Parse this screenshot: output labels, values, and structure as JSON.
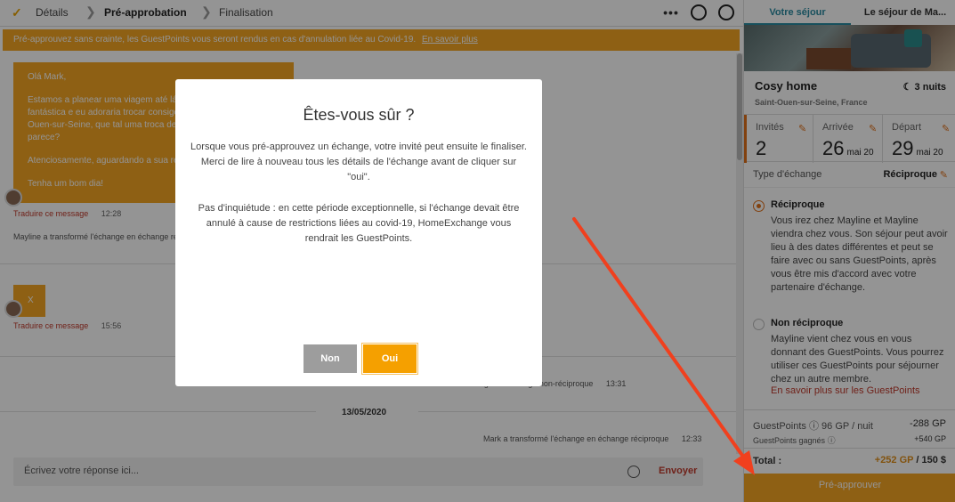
{
  "steps": {
    "details": "Détails",
    "preapproval": "Pré-approbation",
    "finalisation": "Finalisation"
  },
  "banner": {
    "text": "Pré-approuvez sans crainte, les GuestPoints vous seront rendus en cas d'annulation liée au Covid-19.",
    "link": "En savoir plus"
  },
  "messages": {
    "first": {
      "greeting": "Olá Mark,",
      "body": "Estamos a planear uma viagem até lá e a sua casa parece fantástica e eu adoraria trocar consigo. Vivemos em Saint-Ouen-sur-Seine, que tal uma troca de casas? O que lhe parece?",
      "regards": "Atenciosamente, aguardando a sua resposta",
      "bye": "Tenha um bom dia!",
      "translate": "Traduire ce message",
      "time": "12:28"
    },
    "system1": "Mayline a transformé l'échange en échange réciproque",
    "second": {
      "body": "X",
      "translate": "Traduire ce message",
      "time": "15:56"
    },
    "system2": "Mark a transformé l'échange en échange non-réciproque",
    "system2_time": "13:31",
    "date_sep": "13/05/2020",
    "system3": "Mark a transformé l'échange en échange réciproque",
    "system3_time": "12:33"
  },
  "reply": {
    "placeholder": "Écrivez votre réponse ici...",
    "send": "Envoyer"
  },
  "sidebar": {
    "tab_active": "Votre séjour",
    "tab_other": "Le séjour de Ma...",
    "home_name": "Cosy home",
    "nights": "3 nuits",
    "location": "Saint-Ouen-sur-Seine, France",
    "guests_label": "Invités",
    "guests_val": "2",
    "arrival_label": "Arrivée",
    "arrival_day": "26",
    "arrival_month": "mai 20",
    "departure_label": "Départ",
    "departure_day": "29",
    "departure_month": "mai 20",
    "type_label": "Type d'échange",
    "type_val": "Réciproque",
    "opt1_title": "Réciproque",
    "opt1_desc": "Vous irez chez Mayline et Mayline viendra chez vous. Son séjour peut avoir lieu à des dates différentes et peut se faire avec ou sans GuestPoints, après vous être mis d'accord avec votre partenaire d'échange.",
    "opt2_title": "Non réciproque",
    "opt2_desc": "Mayline vient chez vous en vous donnant des GuestPoints. Vous pourrez utiliser ces GuestPoints pour séjourner chez un autre membre.",
    "opt2_link": "En savoir plus sur les GuestPoints",
    "gp_label": "GuestPoints",
    "gp_rate": "96 GP / nuit",
    "gp_cost": "-288 GP",
    "gp_earned_label": "GuestPoints gagnés",
    "gp_earned": "+540 GP",
    "total_label": "Total :",
    "total_gp": "+252 GP",
    "total_price": "/ 150 $",
    "preapprove": "Pré-approuver"
  },
  "modal": {
    "title": "Êtes-vous sûr ?",
    "body1": "Lorsque vous pré-approuvez un échange, votre invité peut ensuite le finaliser. Merci de lire à nouveau tous les détails de l'échange avant de cliquer sur \"oui\".",
    "body2": "Pas d'inquiétude : en cette période exceptionnelle, si l'échange devait être annulé à cause de restrictions liées au covid-19, HomeExchange vous rendrait les GuestPoints.",
    "no": "Non",
    "yes": "Oui"
  },
  "colors": {
    "accent": "#f5a623",
    "link_red": "#c0392b",
    "arrow": "#f0401e"
  }
}
